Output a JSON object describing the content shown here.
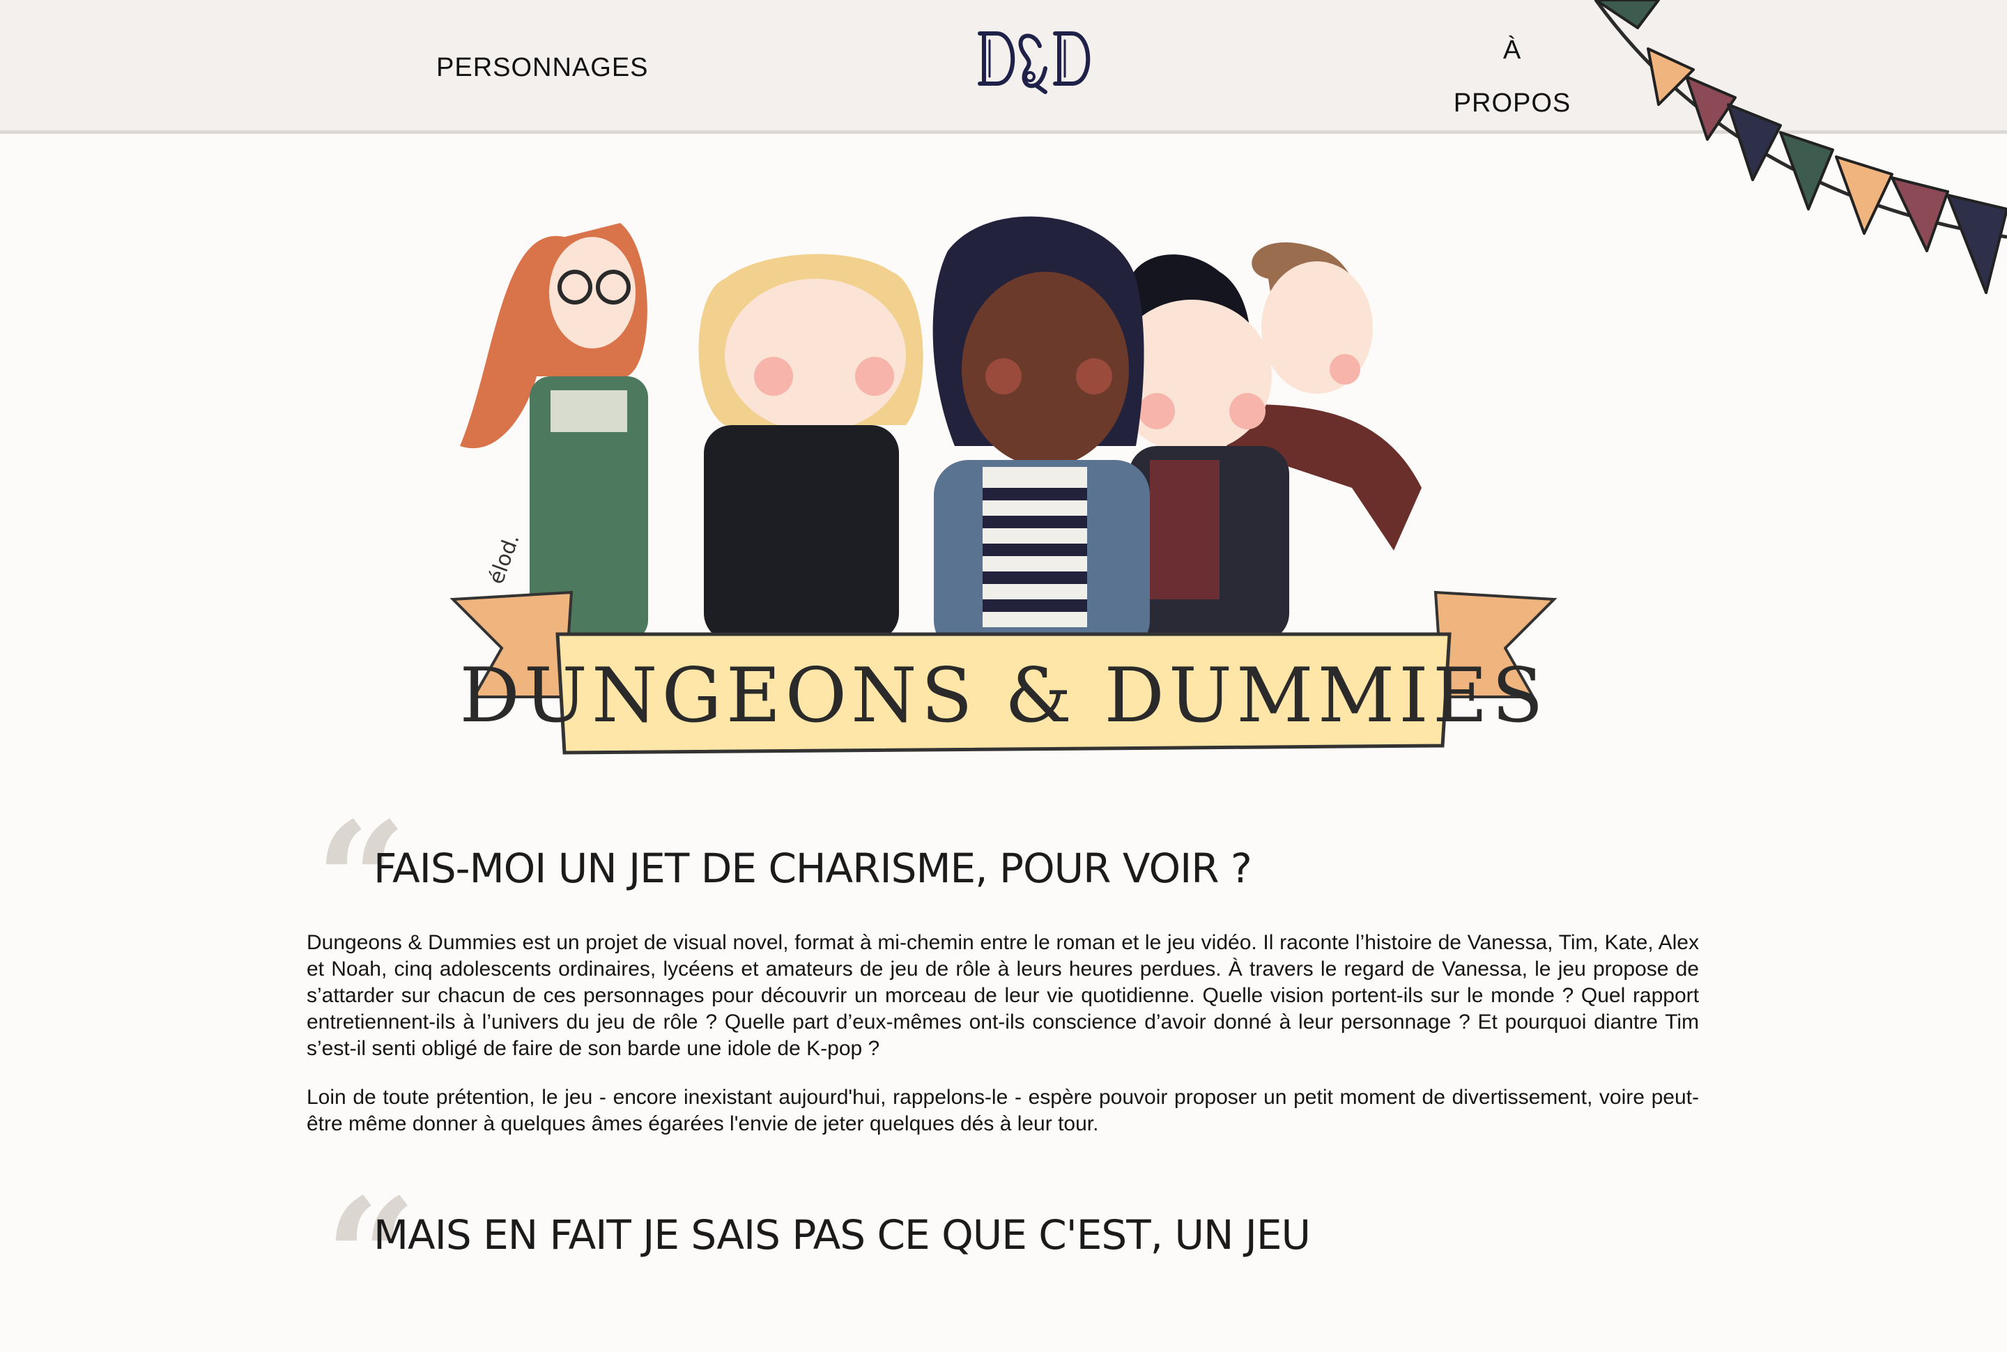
{
  "nav": {
    "personnages_label": "PERSONNAGES",
    "logo_text": "D&D",
    "apropos_label": "À\nPROPOS"
  },
  "hero": {
    "banner_text": "DUNGEONS & DUMMIES",
    "signature": "élod."
  },
  "sections": [
    {
      "title": "FAIS-MOI UN JET DE CHARISME, POUR VOIR ?",
      "paragraphs": [
        "Dungeons & Dummies est un projet de visual novel, format à mi-chemin entre le roman et le jeu vidéo. Il raconte l’histoire de Vanessa, Tim, Kate, Alex et Noah, cinq adolescents ordinaires, lycéens et amateurs de jeu de rôle à leurs heures perdues. À travers le regard de Vanessa, le jeu propose de s’attarder sur chacun de ces personnages pour découvrir un morceau de leur vie quotidienne. Quelle vision portent-ils sur le monde ? Quel rapport entretiennent-ils à l’univers du jeu de rôle ? Quelle part d’eux-mêmes ont-ils conscience d’avoir donné à leur personnage ? Et pourquoi diantre Tim s’est-il senti obligé de faire de son barde une idole de K-pop ?",
        "Loin de toute prétention, le jeu - encore inexistant aujourd'hui, rappelons-le - espère pouvoir proposer un petit moment de divertissement, voire peut-être même donner à quelques âmes égarées l'envie de jeter quelques dés à leur tour."
      ]
    },
    {
      "title": "MAIS EN FAIT JE SAIS PAS CE QUE C'EST, UN JEU"
    }
  ],
  "quote_glyph": "“",
  "colors": {
    "header_bg": "#f3f0ee",
    "page_bg": "#fdfbf9",
    "quote_mark": "#dcd6d0",
    "banner_fill": "#fde6a8",
    "ribbon_fill": "#f0b47e",
    "pennants": [
      "#3d5b4f",
      "#f0b47e",
      "#8b4a55",
      "#2e3049"
    ]
  }
}
